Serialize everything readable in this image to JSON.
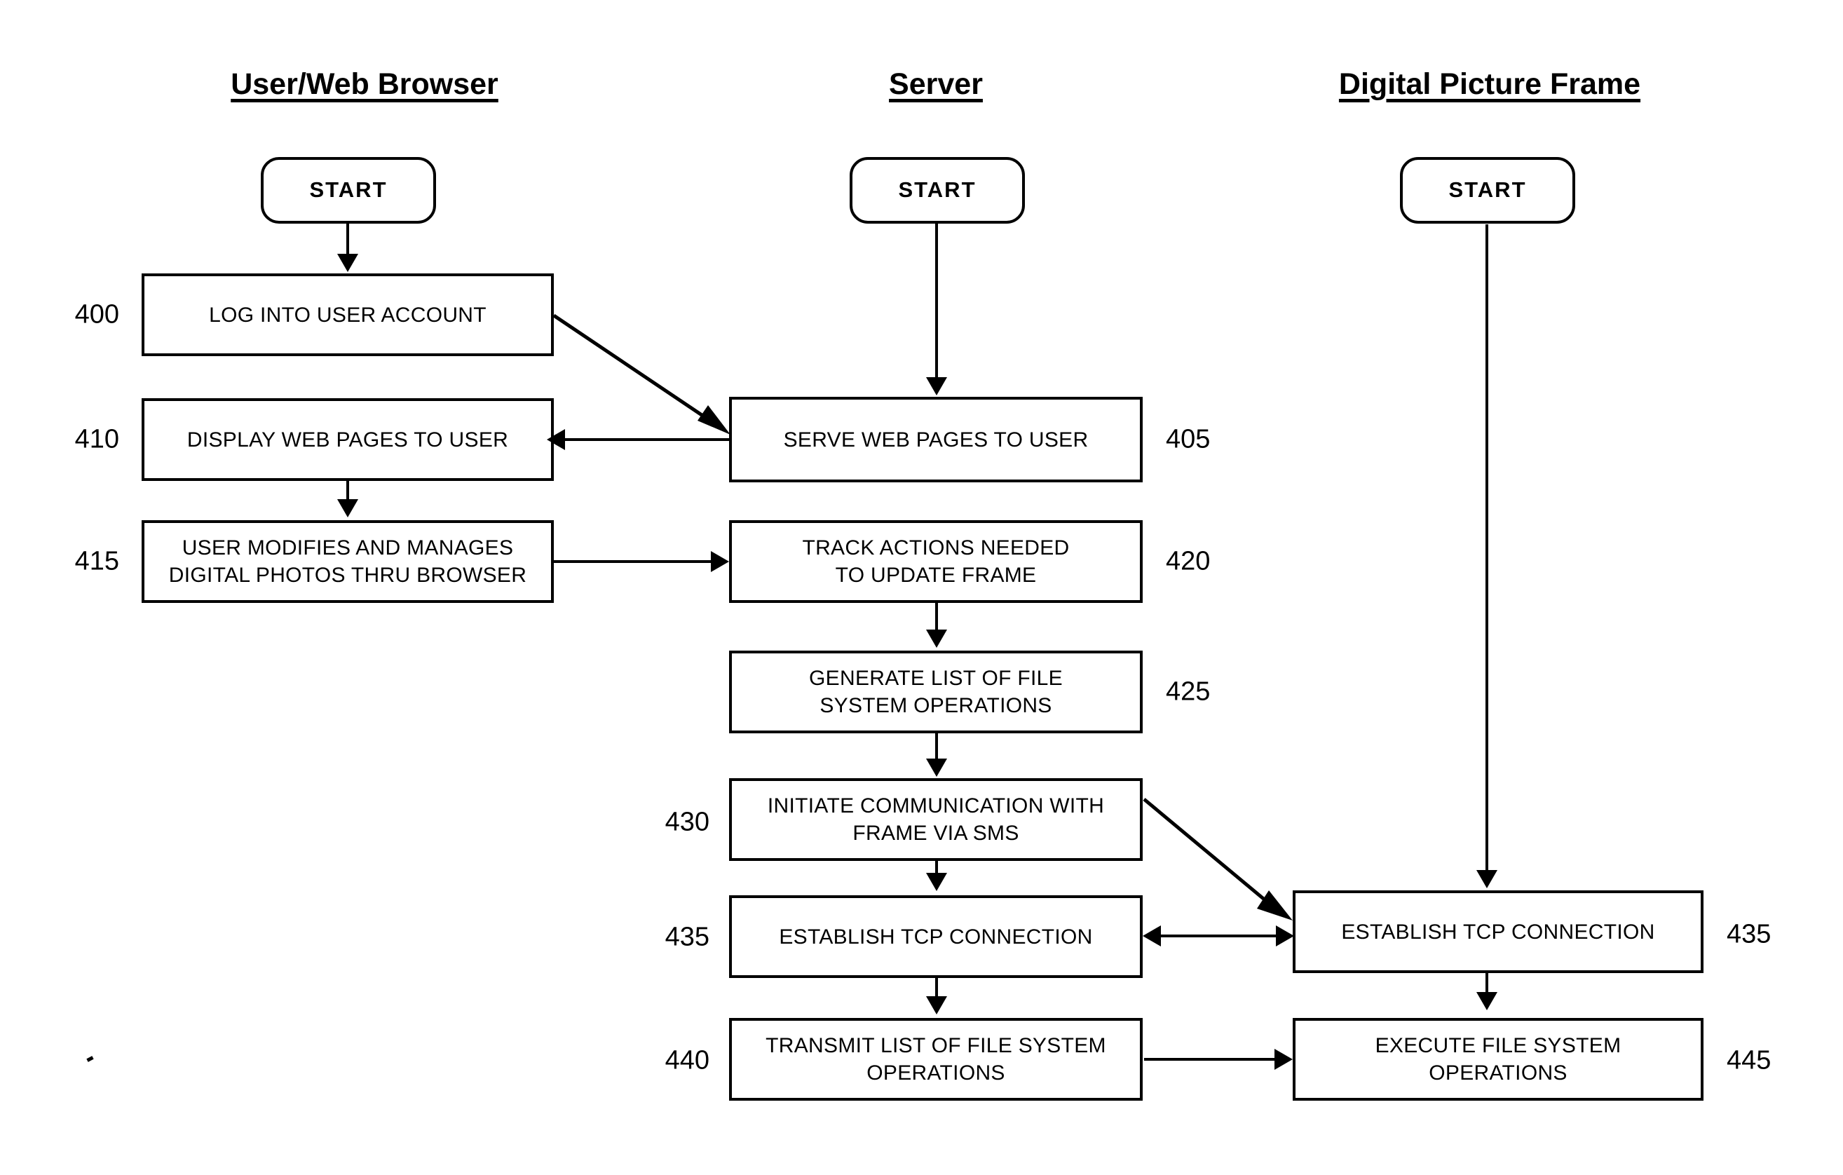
{
  "diagram": {
    "type": "swimlane-flowchart",
    "columns": [
      {
        "id": "user",
        "title": "User/Web Browser"
      },
      {
        "id": "server",
        "title": "Server"
      },
      {
        "id": "frame",
        "title": "Digital Picture Frame"
      }
    ],
    "terminators": {
      "user_start": "START",
      "server_start": "START",
      "frame_start": "START"
    },
    "nodes": {
      "n400": {
        "ref": "400",
        "text": "LOG INTO USER ACCOUNT"
      },
      "n405": {
        "ref": "405",
        "text": "SERVE WEB PAGES TO USER"
      },
      "n410": {
        "ref": "410",
        "text": "DISPLAY WEB PAGES TO USER"
      },
      "n415": {
        "ref": "415",
        "line1": "USER MODIFIES AND MANAGES",
        "line2": "DIGITAL PHOTOS THRU BROWSER"
      },
      "n420": {
        "ref": "420",
        "line1": "TRACK ACTIONS NEEDED",
        "line2": "TO UPDATE FRAME"
      },
      "n425": {
        "ref": "425",
        "line1": "GENERATE LIST OF FILE",
        "line2": "SYSTEM OPERATIONS"
      },
      "n430": {
        "ref": "430",
        "line1": "INITIATE COMMUNICATION WITH",
        "line2": "FRAME VIA SMS"
      },
      "n435s": {
        "ref": "435",
        "text": "ESTABLISH TCP CONNECTION"
      },
      "n440": {
        "ref": "440",
        "line1": "TRANSMIT LIST OF FILE SYSTEM",
        "line2": "OPERATIONS"
      },
      "n435f": {
        "ref": "435",
        "text": "ESTABLISH TCP CONNECTION"
      },
      "n445": {
        "ref": "445",
        "line1": "EXECUTE FILE SYSTEM",
        "line2": "OPERATIONS"
      }
    },
    "colors": {
      "ink": "#000000",
      "paper": "#ffffff"
    }
  }
}
